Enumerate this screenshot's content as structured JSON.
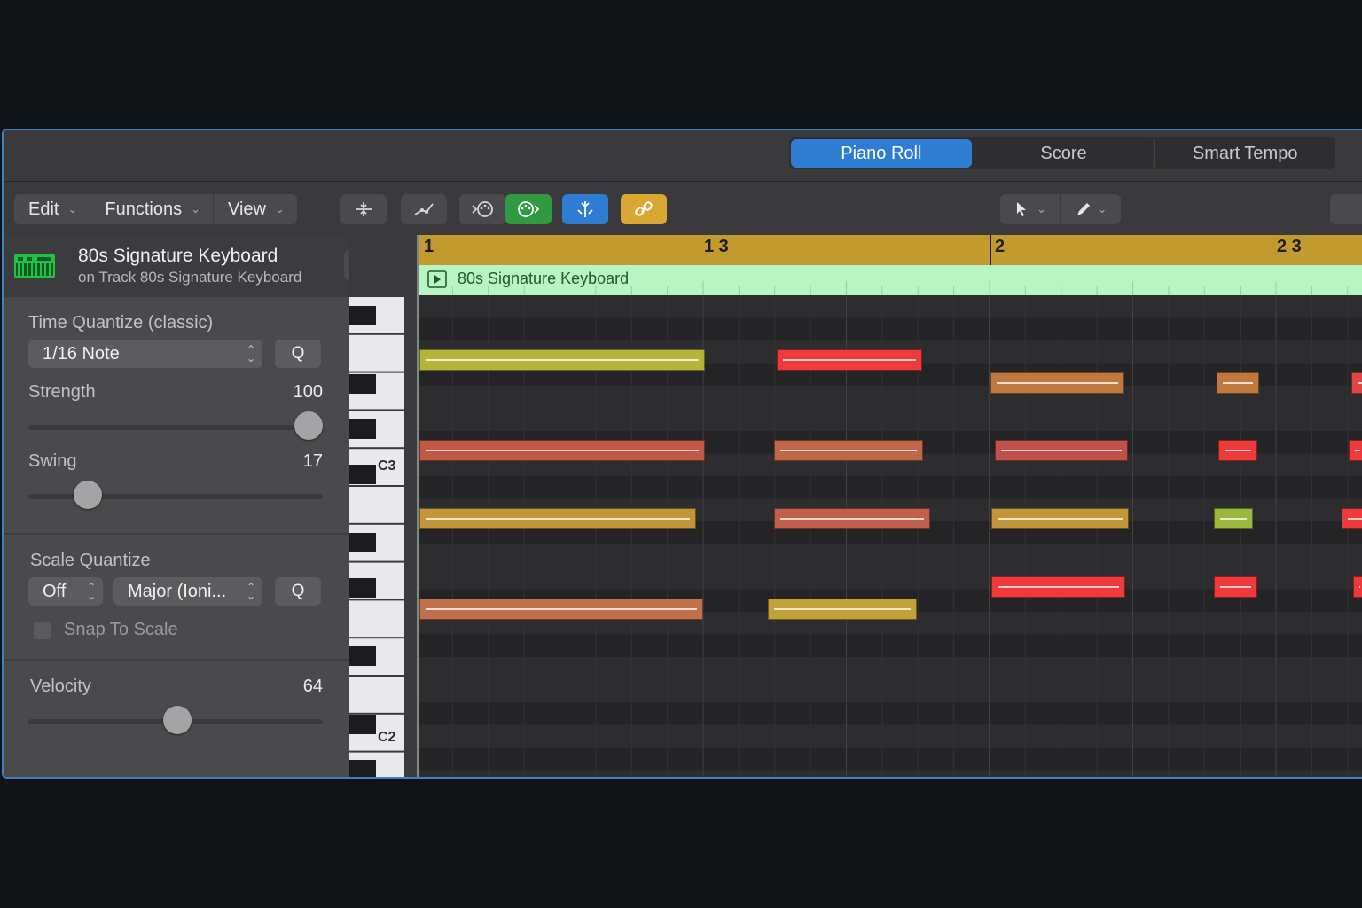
{
  "tabs": [
    {
      "label": "Piano Roll"
    },
    {
      "label": "Score"
    },
    {
      "label": "Smart Tempo"
    }
  ],
  "menus": [
    {
      "label": "Edit"
    },
    {
      "label": "Functions"
    },
    {
      "label": "View"
    }
  ],
  "track": {
    "name": "80s Signature Keyboard",
    "subtitle": "on Track 80s Signature Keyboard"
  },
  "time_quantize": {
    "label": "Time Quantize (classic)",
    "value": "1/16 Note",
    "q_label": "Q",
    "strength_label": "Strength",
    "strength_value": "100",
    "swing_label": "Swing",
    "swing_value": "17"
  },
  "scale_quantize": {
    "label": "Scale Quantize",
    "root_value": "Off",
    "scale_value": "Major (Ioni...",
    "q_label": "Q",
    "snap_label": "Snap To Scale"
  },
  "velocity": {
    "label": "Velocity",
    "value": "64"
  },
  "piano": {
    "c3_label": "C3",
    "c2_label": "C2"
  },
  "ruler": {
    "labels": [
      "1",
      "1 3",
      "2",
      "2 3"
    ]
  },
  "region": {
    "name": "80s Signature Keyboard"
  },
  "colors": {
    "accent": "#2f7dd3",
    "region": "#b9f5c2",
    "ruler": "#c29a2e"
  }
}
